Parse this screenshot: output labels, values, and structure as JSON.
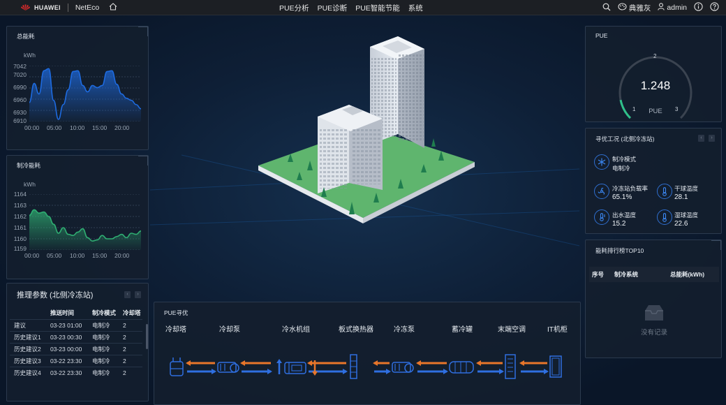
{
  "header": {
    "brand": "HUAWEI",
    "product": "NetEco",
    "menu": [
      "PUE分析",
      "PUE诊断",
      "PUE智能节能",
      "系统"
    ],
    "theme": "典雅灰",
    "user": "admin"
  },
  "total_energy": {
    "title": "总能耗",
    "unit": "kWh",
    "y_ticks": [
      "7042",
      "7020",
      "6990",
      "6960",
      "6930",
      "6910"
    ],
    "x_ticks": [
      "00:00",
      "05:00",
      "10:00",
      "15:00",
      "20:00"
    ],
    "chart_data": {
      "type": "area",
      "x": [
        "00:00",
        "01:00",
        "02:00",
        "03:00",
        "04:00",
        "05:00",
        "06:00",
        "07:00",
        "08:00",
        "09:00",
        "10:00",
        "11:00",
        "12:00",
        "13:00",
        "14:00",
        "15:00",
        "16:00",
        "17:00",
        "18:00",
        "19:00",
        "20:00",
        "21:00",
        "22:00",
        "23:00"
      ],
      "values": [
        6955,
        7000,
        6975,
        7030,
        7035,
        6960,
        6915,
        6950,
        6985,
        7028,
        7030,
        6995,
        6980,
        6995,
        6990,
        6995,
        7028,
        7030,
        6998,
        6975,
        6965,
        6960,
        6950,
        6940
      ],
      "ylim": [
        6910,
        7042
      ],
      "color": "#1e6be0"
    }
  },
  "cooling_energy": {
    "title": "制冷能耗",
    "unit": "kWh",
    "y_ticks": [
      "1164",
      "1163",
      "1162",
      "1161",
      "1160",
      "1159"
    ],
    "x_ticks": [
      "00:00",
      "05:00",
      "10:00",
      "15:00",
      "20:00"
    ],
    "chart_data": {
      "type": "area",
      "x": [
        "00:00",
        "01:00",
        "02:00",
        "03:00",
        "04:00",
        "05:00",
        "06:00",
        "07:00",
        "08:00",
        "09:00",
        "10:00",
        "11:00",
        "12:00",
        "13:00",
        "14:00",
        "15:00",
        "16:00",
        "17:00",
        "18:00",
        "19:00",
        "20:00",
        "21:00",
        "22:00",
        "23:00"
      ],
      "values": [
        1162.1,
        1162.6,
        1162.3,
        1162.4,
        1162.0,
        1161.3,
        1160.5,
        1161.0,
        1160.4,
        1160.3,
        1160.6,
        1160.9,
        1160.1,
        1159.8,
        1159.9,
        1160.3,
        1160.0,
        1160.0,
        1160.2,
        1160.4,
        1160.1,
        1160.5,
        1160.4,
        1160.7
      ],
      "ylim": [
        1159,
        1164
      ],
      "color": "#2fae72"
    }
  },
  "inference": {
    "title": "推理参数 (北侧冷冻站)",
    "columns": [
      "",
      "推送时间",
      "制冷模式",
      "冷却塔"
    ],
    "rows": [
      [
        "建议",
        "03-23 01:00",
        "电制冷",
        "2"
      ],
      [
        "历史建议1",
        "03-23 00:30",
        "电制冷",
        "2"
      ],
      [
        "历史建议2",
        "03-23 00:00",
        "电制冷",
        "2"
      ],
      [
        "历史建议3",
        "03-22 23:30",
        "电制冷",
        "2"
      ],
      [
        "历史建议4",
        "03-22 23:30",
        "电制冷",
        "2"
      ]
    ]
  },
  "pue": {
    "title": "PUE",
    "value": "1.248",
    "value_num": 1.248,
    "label": "PUE",
    "min": "1",
    "mid": "2",
    "max": "3",
    "range": [
      1,
      3
    ],
    "accent": "#2fc08a"
  },
  "conditions": {
    "title": "寻优工况 (北侧冷冻站)",
    "mode_label": "制冷模式",
    "mode_value": "电制冷",
    "load_label": "冷冻站负载率",
    "load_value": "65.1%",
    "dry_label": "干球温度",
    "dry_value": "28.1",
    "outlet_label": "出水温度",
    "outlet_value": "15.2",
    "wet_label": "湿球温度",
    "wet_value": "22.6"
  },
  "ranking": {
    "title": "能耗排行榜TOP10",
    "columns": [
      "序号",
      "制冷系统",
      "总能耗(kWh)"
    ],
    "empty": "没有记录"
  },
  "pue_opt": {
    "title": "PUE寻优",
    "equipment": [
      "冷却塔",
      "冷却泵",
      "冷水机组",
      "板式换热器",
      "冷冻泵",
      "蓄冷罐",
      "末端空调",
      "IT机柜"
    ],
    "hot_color": "#e8762a",
    "cold_color": "#2f6fe0"
  }
}
